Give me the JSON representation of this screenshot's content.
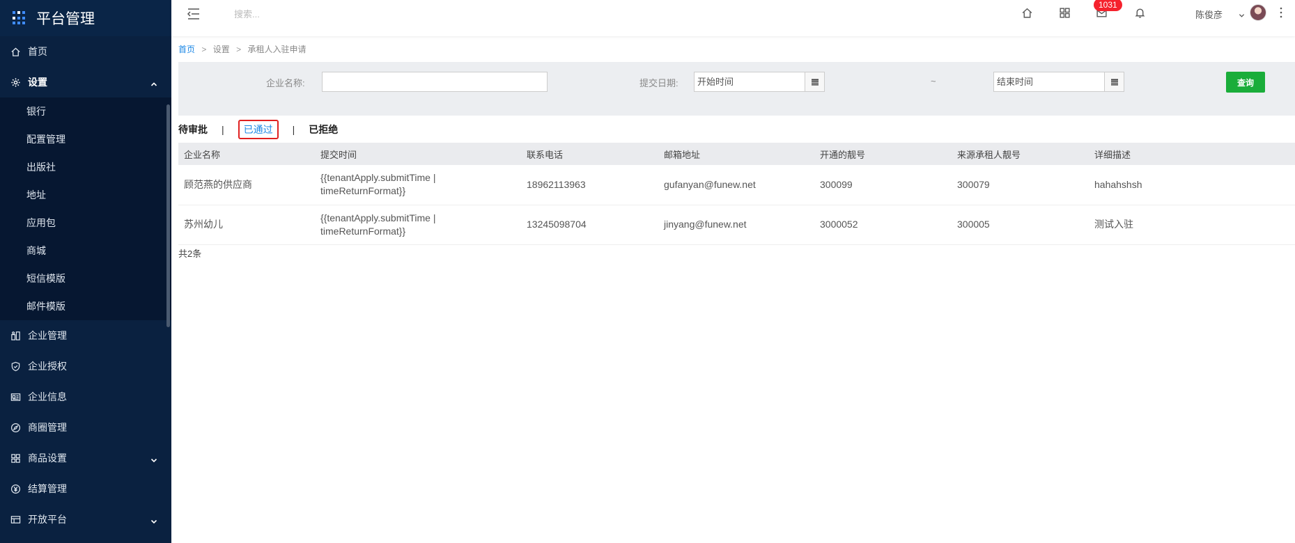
{
  "sidebar": {
    "brand_title": "平台管理",
    "items": [
      {
        "label": "首页",
        "icon": "home-icon"
      },
      {
        "label": "设置",
        "icon": "gear-icon",
        "open": true
      },
      {
        "label": "企业管理",
        "icon": "building-icon"
      },
      {
        "label": "企业授权",
        "icon": "shield-icon"
      },
      {
        "label": "企业信息",
        "icon": "id-card-icon"
      },
      {
        "label": "商圈管理",
        "icon": "compass-icon"
      },
      {
        "label": "商品设置",
        "icon": "grid-icon"
      },
      {
        "label": "结算管理",
        "icon": "yen-icon"
      },
      {
        "label": "开放平台",
        "icon": "table-icon"
      }
    ],
    "sub_items": [
      "银行",
      "配置管理",
      "出版社",
      "地址",
      "应用包",
      "商城",
      "短信模版",
      "邮件模版"
    ]
  },
  "topbar": {
    "search_placeholder": "搜索...",
    "badge_count": "1031",
    "user_name": "陈俊彦"
  },
  "breadcrumb": {
    "home": "首页",
    "sep": ">",
    "level2": "设置",
    "current": "承租人入驻申请"
  },
  "filter": {
    "company_label": "企业名称:",
    "company_value": "",
    "date_label": "提交日期:",
    "start_placeholder": "开始时间",
    "tilde": "~",
    "end_placeholder": "结束时间",
    "query_label": "查询"
  },
  "tabs": {
    "pending": "待审批",
    "sep": "|",
    "approved": "已通过",
    "rejected": "已拒绝"
  },
  "table": {
    "headers": [
      "企业名称",
      "提交时间",
      "联系电话",
      "邮箱地址",
      "开通的靓号",
      "来源承租人靓号",
      "详细描述"
    ],
    "rows": [
      [
        "顾范燕的供应商",
        "{{tenantApply.submitTime | timeReturnFormat}}",
        "18962113963",
        "gufanyan@funew.net",
        "300099",
        "300079",
        "hahahshsh"
      ],
      [
        "苏州幼儿",
        "{{tenantApply.submitTime | timeReturnFormat}}",
        "13245098704",
        "jinyang@funew.net",
        "3000052",
        "300005",
        "测试入驻"
      ]
    ]
  },
  "total_text": "共2条",
  "colors": {
    "sidebar_bg": "#0a2140",
    "accent_blue": "#1e88e5",
    "query_green": "#1aad3a",
    "badge_red": "#f5222d",
    "highlight_red": "#e02020"
  }
}
